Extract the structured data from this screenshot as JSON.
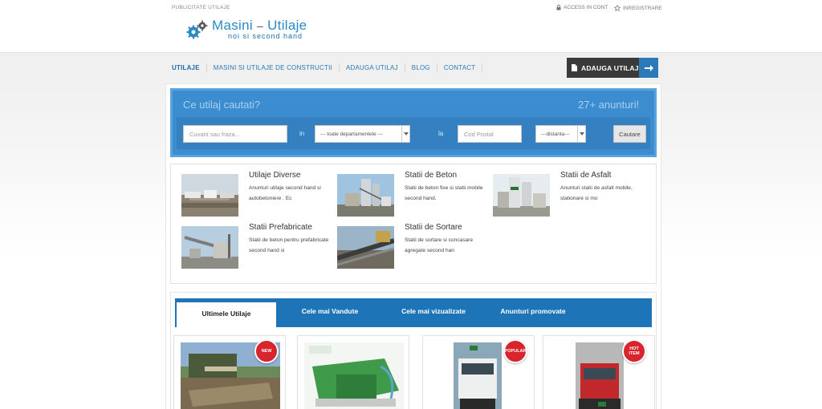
{
  "header": {
    "publicity": "PUBLICITATE UTILAJE",
    "access": "ACCESS IN CONT",
    "register": "INREGISTRARE",
    "logo_title_main": "Masini",
    "logo_title_dash": "–",
    "logo_title_second": "Utilaje",
    "logo_subtitle": "noi si second hand"
  },
  "nav": {
    "items": [
      {
        "label": "UTILAJE"
      },
      {
        "label": "MASINI SI UTILAJE DE CONSTRUCTII"
      },
      {
        "label": "ADAUGA UTILAJ"
      },
      {
        "label": "BLOG"
      },
      {
        "label": "CONTACT"
      }
    ],
    "add_button": "ADAUGA UTILAJ"
  },
  "search": {
    "question": "Ce utilaj cautati?",
    "count": "27+ anunturi!",
    "keyword_placeholder": "Cuvant sau fraza...",
    "in_label": "in",
    "department_selected": "--- toate departamentele ---",
    "la_label": "la",
    "postal_placeholder": "Cod Postal",
    "distance_selected": "---distanta---",
    "button": "Cautare"
  },
  "categories": [
    {
      "title": "Utilaje Diverse",
      "desc": "Anunturi utilaje second hand si autobetoniere . Ec"
    },
    {
      "title": "Statii de Beton",
      "desc": "Statii de beton fixe si statii mobile second hand."
    },
    {
      "title": "Statii de Asfalt",
      "desc": "Anunturi statii de asfalt mobile, stationare si mo"
    },
    {
      "title": "Statii Prefabricate",
      "desc": "Statii de beton pentru prefabricate second hand si"
    },
    {
      "title": "Statii de Sortare",
      "desc": "Statii de sortare si concasare agregate second han"
    }
  ],
  "tabs": [
    {
      "label": "Ultimele Utilaje"
    },
    {
      "label": "Cele mai Vandute"
    },
    {
      "label": "Cele mai vizualizate"
    },
    {
      "label": "Anunturi promovate"
    }
  ],
  "listings": [
    {
      "badge": "NEW"
    },
    {
      "badge": ""
    },
    {
      "badge": "POPULAR"
    },
    {
      "badge": "HOT ITEM"
    }
  ],
  "colors": {
    "accent_blue": "#1d75b7",
    "search_blue": "#3b8dd0",
    "badge_red": "#d8242c",
    "dark_button": "#3a3a3a"
  }
}
